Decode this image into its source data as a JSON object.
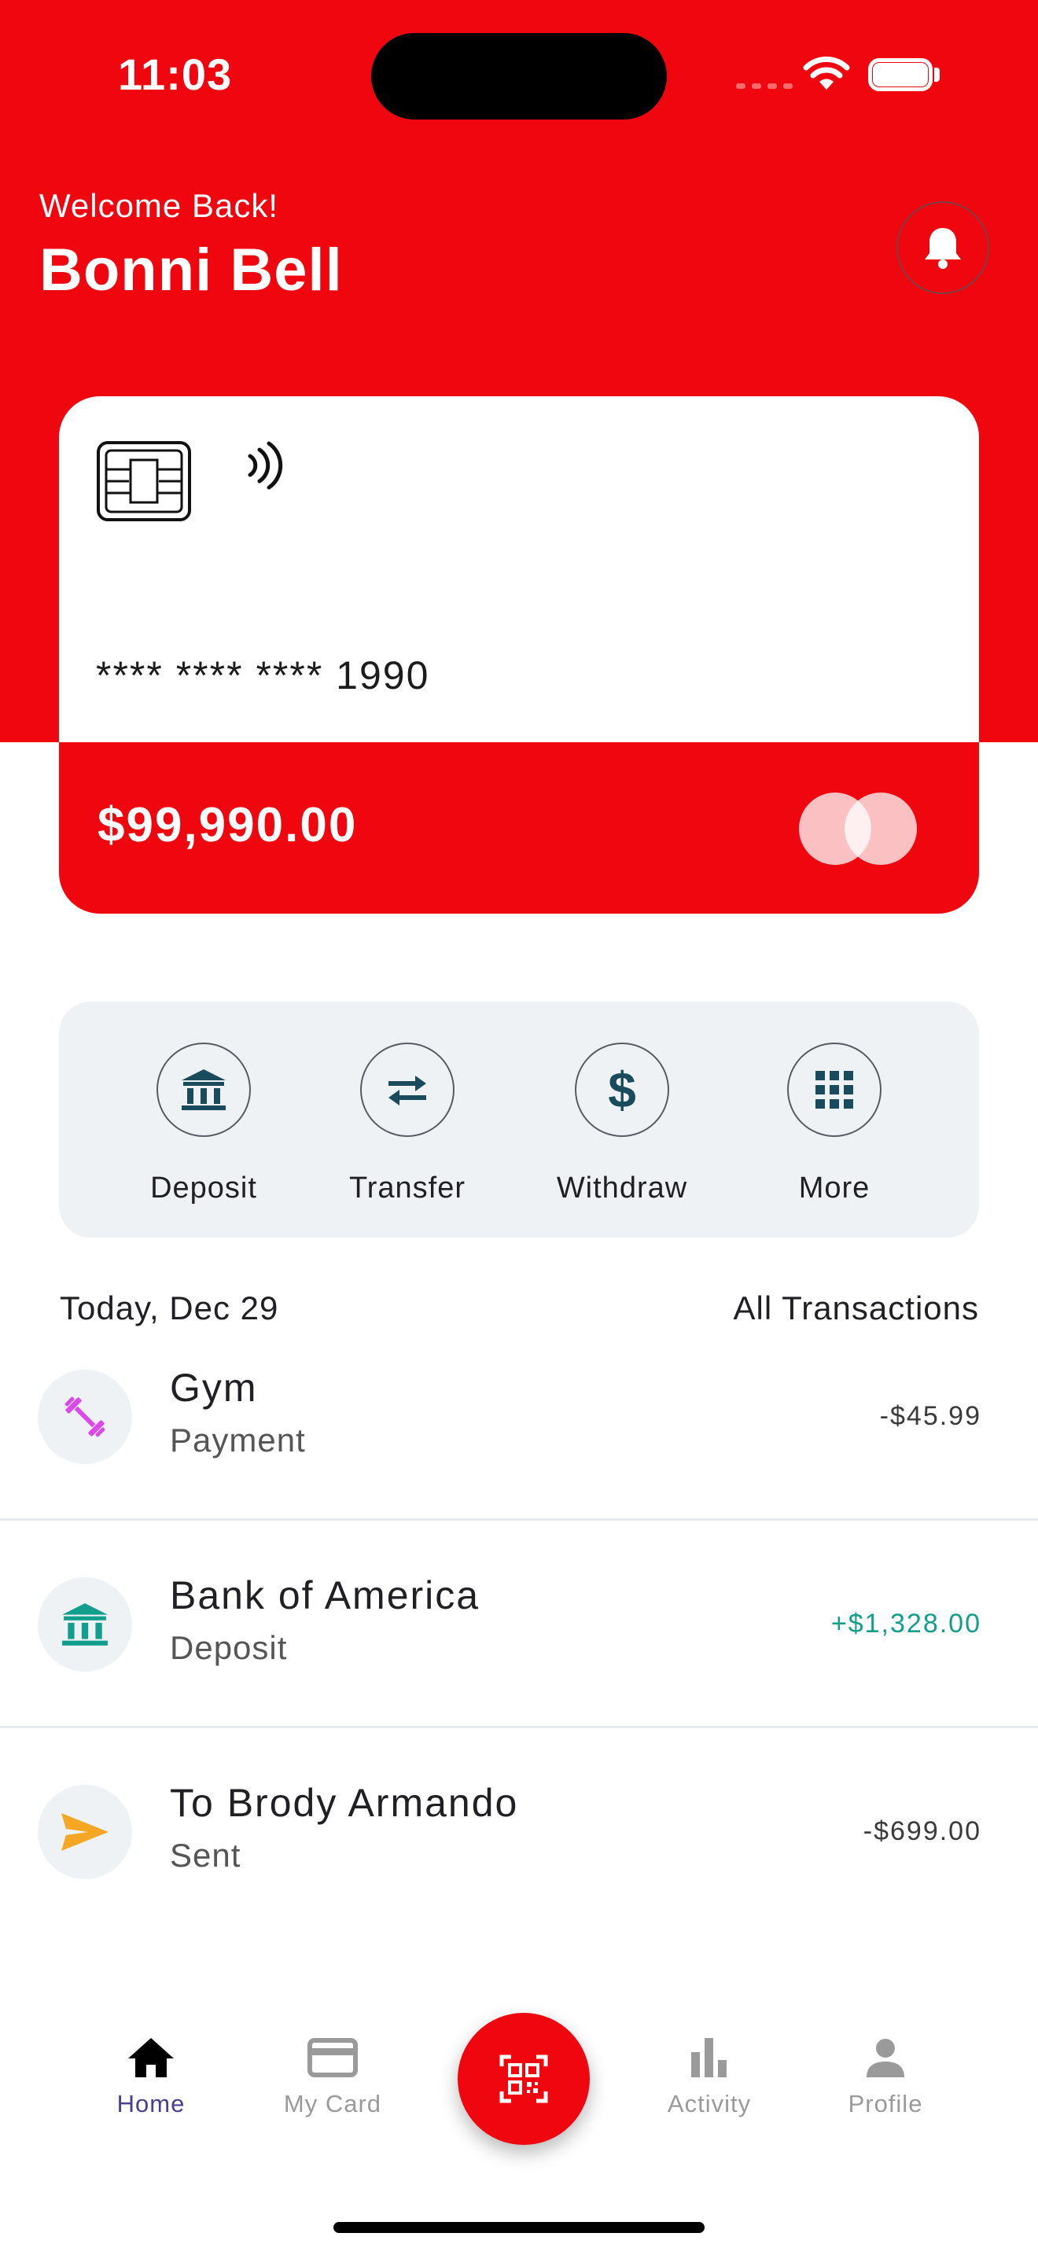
{
  "status_bar": {
    "time": "11:03"
  },
  "header": {
    "welcome": "Welcome Back!",
    "user_name": "Bonni Bell"
  },
  "card": {
    "number": "**** **** **** 1990",
    "balance": "$99,990.00"
  },
  "quick_actions": [
    {
      "label": "Deposit",
      "icon": "bank-icon"
    },
    {
      "label": "Transfer",
      "icon": "transfer-arrows-icon"
    },
    {
      "label": "Withdraw",
      "icon": "dollar-icon"
    },
    {
      "label": "More",
      "icon": "grid-icon"
    }
  ],
  "transactions_header": {
    "date": "Today, Dec 29",
    "link": "All Transactions"
  },
  "transactions": [
    {
      "name": "Gym",
      "type": "Payment",
      "amount": "-$45.99",
      "icon": "dumbbell-icon",
      "color": "#3a3a3a"
    },
    {
      "name": "Bank of America",
      "type": "Deposit",
      "amount": "+$1,328.00",
      "icon": "bank-icon",
      "color": "#129e8c"
    },
    {
      "name": "To Brody Armando",
      "type": "Sent",
      "amount": "-$699.00",
      "icon": "send-icon",
      "color": "#3a3a3a"
    }
  ],
  "bottom_nav": [
    {
      "label": "Home",
      "icon": "home-icon",
      "active": true
    },
    {
      "label": "My Card",
      "icon": "card-icon",
      "active": false
    },
    {
      "label": "Activity",
      "icon": "bar-chart-icon",
      "active": false
    },
    {
      "label": "Profile",
      "icon": "person-icon",
      "active": false
    }
  ],
  "colors": {
    "brand_red": "#f0060e",
    "nav_active": "#4b3d8f",
    "nav_inactive": "#9a9a9a",
    "positive": "#129e8c"
  }
}
